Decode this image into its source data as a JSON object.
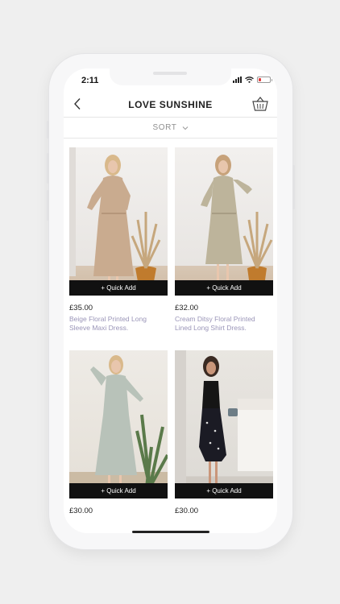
{
  "status": {
    "time": "2:11"
  },
  "header": {
    "title": "LOVE SUNSHINE",
    "back_icon": "chevron-left-icon",
    "cart_icon": "basket-icon"
  },
  "sort": {
    "label": "SORT"
  },
  "colors": {
    "accent": "#111111",
    "name_text": "#9a95b8",
    "battery": "#e23b3b"
  },
  "products": [
    {
      "price": "£35.00",
      "name": "Beige Floral Printed Long Sleeve Maxi Dress.",
      "quick_add": "+ Quick Add"
    },
    {
      "price": "£32.00",
      "name": "Cream Ditsy Floral Printed Lined Long Shirt Dress.",
      "quick_add": "+ Quick Add"
    },
    {
      "price": "£30.00",
      "name": "",
      "quick_add": "+ Quick Add"
    },
    {
      "price": "£30.00",
      "name": "",
      "quick_add": "+ Quick Add"
    }
  ]
}
